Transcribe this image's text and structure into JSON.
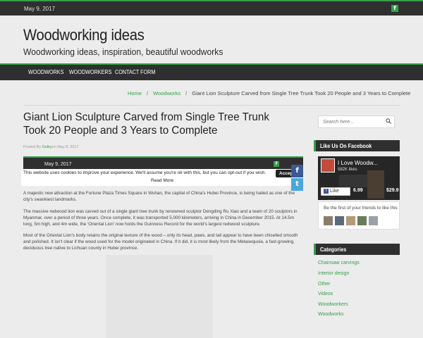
{
  "topbar": {
    "date": "May 9, 2017",
    "fb_icon": "f"
  },
  "site": {
    "title": "Woodworking ideas",
    "description": "Woodworking ideas, inspiration, beautiful woodworks"
  },
  "nav": {
    "items": [
      "WOODWORKS",
      "WOODWORKERS",
      "CONTACT FORM"
    ]
  },
  "breadcrumb": {
    "home": "Home",
    "sep": "/",
    "section": "Woodworks",
    "current": "Giant Lion Sculpture Carved from Single Tree Trunk Took 20 People and 3 Years to Complete"
  },
  "post": {
    "title": "Giant Lion Sculpture Carved from Single Tree Trunk Took 20 People and 3 Years to Complete",
    "meta_prefix": "Posted By",
    "author": "Golky",
    "meta_date": "on May 8, 2017",
    "bar_date": "May 9, 2017",
    "paragraphs": [
      "A majestic new attraction at the Fortune Plaza Times Square in Wuhan, the capital of China's Hubei Province, is being hailed as one of the city's swankiest landmarks.",
      "The massive redwood lion was carved out of a single giant tree trunk by renowned sculptor Dengding Ru Xiao and a team of 20 sculptors in Myanmar, over a period of three years. Once complete, it was transported 5,000 kilometers, arriving in China in December 2015. At 14.5m long, 5m high, and 4m wide, the 'Oriental Lion' now holds the Guinness Record for the world's largest redwood sculpture.",
      "Most of the Oriental Lion's body retains the original texture of the wood – only its head, paws, and tail appear to have been chiselled smooth and polished. It isn't clear if the wood used for the model originated in China. If it did, it is most likely from the Metasequoia, a fast-growing, deciduous tree native to Lichuan county in Hubei province."
    ]
  },
  "cookie": {
    "message": "This website uses cookies to improve your experience. We'll assume you're ok with this, but you can opt-out if you wish.",
    "accept": "Accept",
    "read_more": "Read More"
  },
  "share": {
    "facebook": "f",
    "twitter": "t"
  },
  "sidebar": {
    "search_placeholder": "Search here...",
    "facebook_head": "Like Us On Facebook",
    "fb_page_name": "I Love Woodw...",
    "fb_likes": "582K likes",
    "fb_like_button": "Like Page",
    "fb_prices": [
      "6.99",
      "$29.9"
    ],
    "fb_friends": "Be the first of your friends to like this",
    "categories_head": "Categories",
    "categories": [
      "Chainsaw carvings",
      "Interior design",
      "Other",
      "Videos",
      "Woodworkers",
      "Woodworks"
    ]
  },
  "colors": {
    "accent": "#35a04a",
    "dark": "#2f2f2f",
    "facebook": "#3b5998",
    "twitter": "#4aa7dd"
  }
}
